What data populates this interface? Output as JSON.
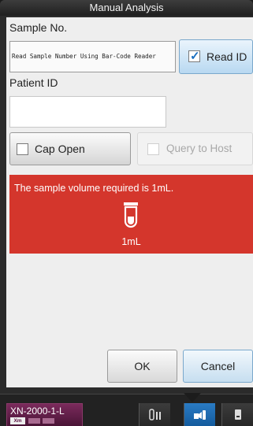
{
  "window": {
    "title": "Manual Analysis"
  },
  "sample": {
    "label": "Sample No.",
    "value": "Read Sample Number Using Bar-Code Reader",
    "read_id_label": "Read ID",
    "read_id_checked": true
  },
  "patient": {
    "label": "Patient ID",
    "value": ""
  },
  "options": {
    "cap_open_label": "Cap Open",
    "cap_open_checked": false,
    "query_host_label": "Query to Host",
    "query_host_enabled": false
  },
  "alert": {
    "message": "The sample volume required is 1mL.",
    "volume": "1mL",
    "icon": "sample-tube-icon",
    "color": "#d4362c"
  },
  "buttons": {
    "ok": "OK",
    "cancel": "Cancel"
  },
  "taskbar": {
    "device_name": "XN-2000-1-L",
    "device_badge": "Xm",
    "icons": [
      "tubes-icon",
      "sampler-icon",
      "storage-icon"
    ],
    "active_index": 1
  }
}
